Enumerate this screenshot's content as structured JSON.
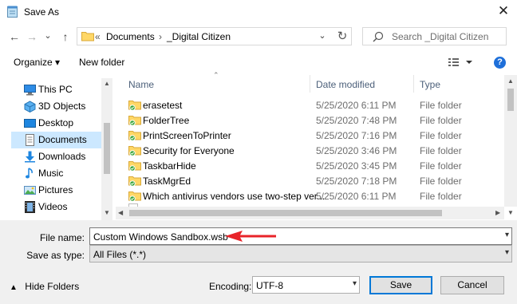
{
  "window": {
    "title": "Save As",
    "close_glyph": "✕"
  },
  "nav": {
    "back": "←",
    "forward": "→",
    "recent": "⌄",
    "up": "↑",
    "refresh": "↻"
  },
  "address": {
    "overflow": "«",
    "crumbs": [
      "Documents",
      "_Digital Citizen"
    ],
    "sep": "›"
  },
  "search": {
    "placeholder": "Search _Digital Citizen"
  },
  "toolbar": {
    "organize": "Organize ▾",
    "new_folder": "New folder",
    "help": "?"
  },
  "sidebar": {
    "items": [
      {
        "label": "This PC",
        "icon": "pc-icon"
      },
      {
        "label": "3D Objects",
        "icon": "cube-icon"
      },
      {
        "label": "Desktop",
        "icon": "desktop-icon"
      },
      {
        "label": "Documents",
        "icon": "documents-icon",
        "selected": true
      },
      {
        "label": "Downloads",
        "icon": "download-icon"
      },
      {
        "label": "Music",
        "icon": "music-icon"
      },
      {
        "label": "Pictures",
        "icon": "pictures-icon"
      },
      {
        "label": "Videos",
        "icon": "videos-icon"
      }
    ]
  },
  "columns": {
    "name": "Name",
    "date": "Date modified",
    "type": "Type"
  },
  "files": [
    {
      "name": "erasetest",
      "date": "5/25/2020 6:11 PM",
      "type": "File folder"
    },
    {
      "name": "FolderTree",
      "date": "5/25/2020 7:48 PM",
      "type": "File folder"
    },
    {
      "name": "PrintScreenToPrinter",
      "date": "5/25/2020 7:16 PM",
      "type": "File folder"
    },
    {
      "name": "Security for Everyone",
      "date": "5/25/2020 3:46 PM",
      "type": "File folder"
    },
    {
      "name": "TaskbarHide",
      "date": "5/25/2020 3:45 PM",
      "type": "File folder"
    },
    {
      "name": "TaskMgrEd",
      "date": "5/25/2020 7:18 PM",
      "type": "File folder"
    },
    {
      "name": "Which antivirus vendors use two-step ver...",
      "date": "5/25/2020 6:11 PM",
      "type": "File folder"
    }
  ],
  "form": {
    "file_name_label": "File name:",
    "file_name_value": "Custom Windows Sandbox.wsb",
    "save_as_type_label": "Save as type:",
    "save_as_type_value": "All Files  (*.*)",
    "encoding_label": "Encoding:",
    "encoding_value": "UTF-8",
    "save": "Save",
    "cancel": "Cancel",
    "hide_folders": "Hide Folders"
  },
  "colors": {
    "selection": "#cce8ff",
    "arrow": "#e8242a",
    "accent": "#0078d7"
  }
}
